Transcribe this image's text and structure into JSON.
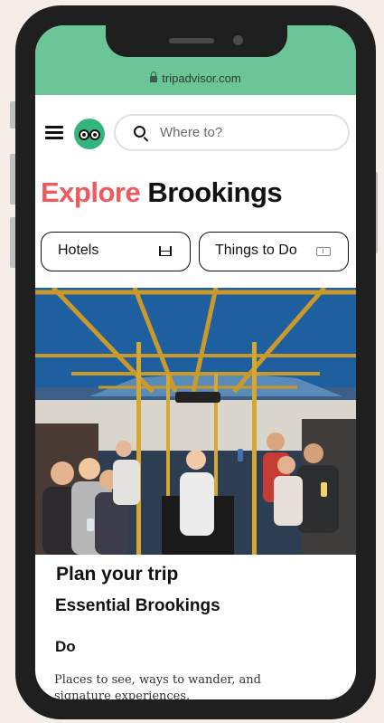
{
  "browser": {
    "url": "tripadvisor.com"
  },
  "header": {
    "menu_icon": "hamburger-menu-icon",
    "logo_icon": "tripadvisor-owl-icon",
    "search_placeholder": "Where to?"
  },
  "page": {
    "title_accent": "Explore",
    "title_main": "Brookings"
  },
  "quick_links": [
    {
      "label": "Hotels",
      "icon": "bed-icon"
    },
    {
      "label": "Things to Do",
      "icon": "ticket-icon"
    }
  ],
  "content": {
    "plan_heading": "Plan your trip",
    "essential_heading": "Essential Brookings",
    "do_heading": "Do",
    "do_description": "Places to see, ways to wander, and signature experiences."
  },
  "colors": {
    "brand_green": "#6cc596",
    "owl_green": "#35b57e",
    "title_accent": "#ef5a5f"
  }
}
